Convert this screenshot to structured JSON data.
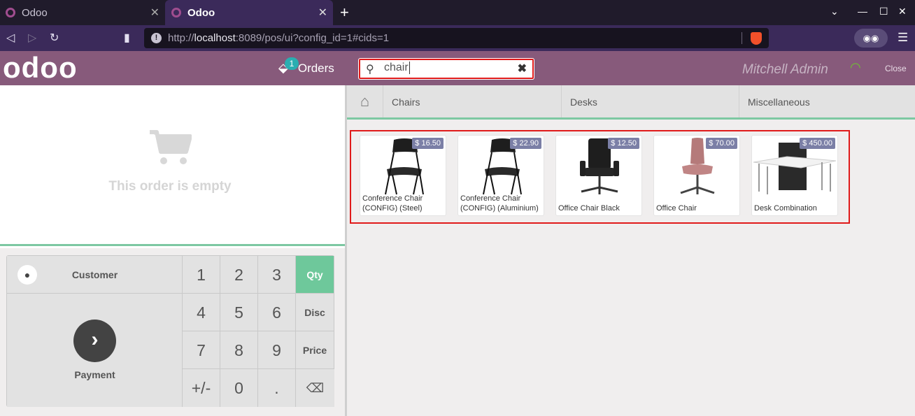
{
  "browser": {
    "tabs": [
      {
        "title": "Odoo",
        "active": false
      },
      {
        "title": "Odoo",
        "active": true
      }
    ],
    "url_scheme": "http://",
    "url_host": "localhost",
    "url_rest": ":8089/pos/ui?config_id=1#cids=1"
  },
  "header": {
    "logo": "odoo",
    "orders_label": "Orders",
    "orders_count": "1",
    "search_value": "chair",
    "cashier": "Mitchell Admin",
    "close_label": "Close"
  },
  "order": {
    "empty_text": "This order is empty"
  },
  "control": {
    "customer_label": "Customer",
    "payment_label": "Payment",
    "keys": [
      "1",
      "2",
      "3",
      "4",
      "5",
      "6",
      "7",
      "8",
      "9",
      "+/-",
      "0",
      "."
    ],
    "modes": [
      "Qty",
      "Disc",
      "Price"
    ],
    "selected_mode": "Qty",
    "backspace_icon": "backspace-icon"
  },
  "categories": [
    "Chairs",
    "Desks",
    "Miscellaneous"
  ],
  "products": [
    {
      "name": "Conference Chair (CONFIG) (Steel)",
      "price": "$ 16.50"
    },
    {
      "name": "Conference Chair (CONFIG) (Aluminium)",
      "price": "$ 22.90"
    },
    {
      "name": "Office Chair Black",
      "price": "$ 12.50"
    },
    {
      "name": "Office Chair",
      "price": "$ 70.00"
    },
    {
      "name": "Desk Combination",
      "price": "$ 450.00"
    }
  ],
  "colors": {
    "header": "#875a7b",
    "accent_green": "#6ec89b",
    "highlight": "#e01a1a"
  }
}
